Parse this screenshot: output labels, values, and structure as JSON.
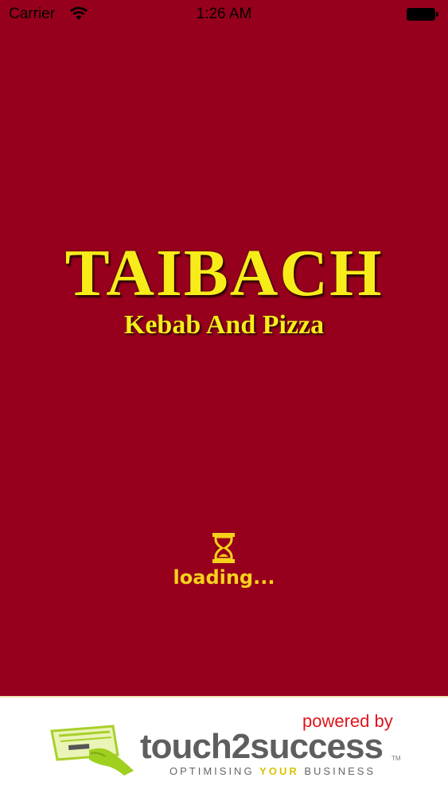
{
  "status_bar": {
    "carrier": "Carrier",
    "time": "1:26 AM",
    "icons": [
      "wifi-icon",
      "battery-icon"
    ]
  },
  "splash": {
    "title": "TAIBACH",
    "subtitle": "Kebab And Pizza",
    "loading_text": "loading...",
    "loading_icon": "hourglass-icon"
  },
  "footer": {
    "powered_by": "powered by",
    "brand": "touch2success",
    "tm": "TM",
    "tagline_pre": "OPTIMISING ",
    "tagline_highlight": "YOUR",
    "tagline_post": " BUSINESS",
    "logo_icon": "card-in-hand-icon"
  },
  "colors": {
    "background": "#97001c",
    "title": "#f7ec1a",
    "loading": "#f7d21a",
    "powered_by": "#e0141c",
    "brand_text": "#5e5e5e"
  }
}
